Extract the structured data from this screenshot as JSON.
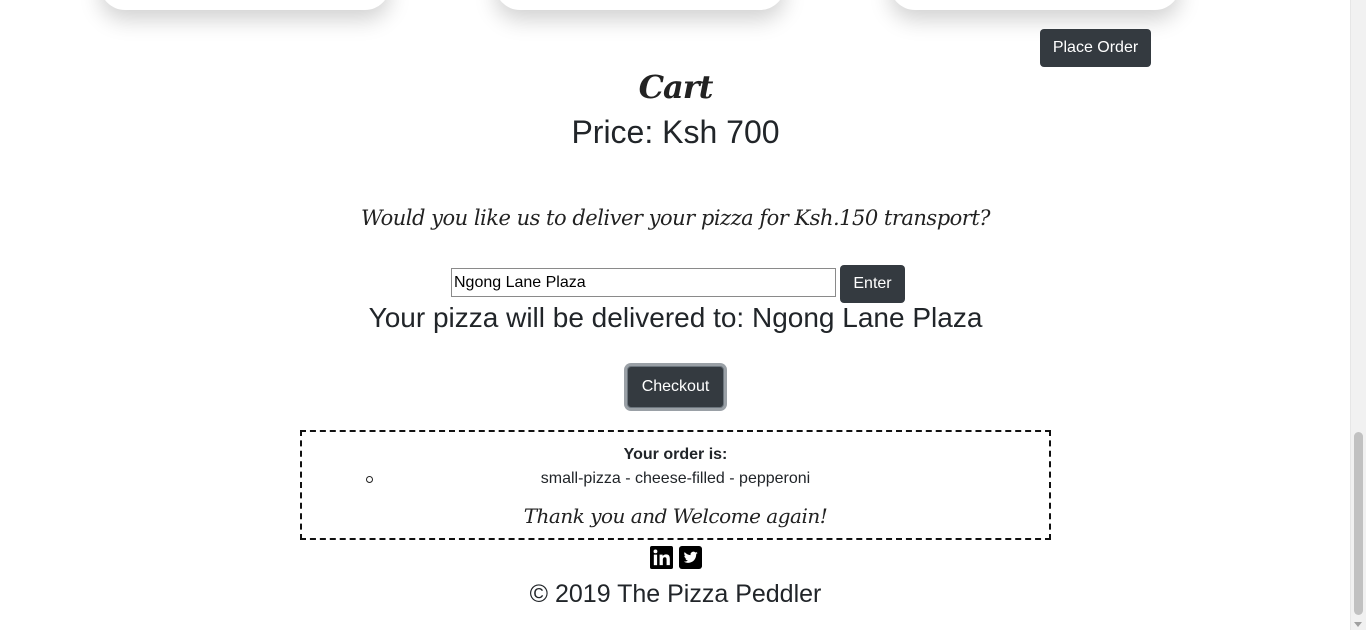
{
  "header": {
    "place_order_label": "Place Order"
  },
  "cart": {
    "title": "Cart",
    "price_text": "Price: Ksh 700"
  },
  "delivery": {
    "question": "Would you like us to deliver your pizza for Ksh.150 transport?",
    "address_value": "Ngong Lane Plaza",
    "enter_label": "Enter",
    "delivered_to_text": "Your pizza will be delivered to: Ngong Lane Plaza"
  },
  "checkout": {
    "label": "Checkout"
  },
  "order": {
    "heading": "Your order is:",
    "items": [
      "small-pizza - cheese-filled - pepperoni"
    ],
    "thanks": "Thank you and Welcome again!"
  },
  "footer": {
    "icons": [
      "linkedin-icon",
      "twitter-icon"
    ],
    "copyright": "© 2019 The Pizza Peddler"
  },
  "colors": {
    "button_bg": "#343a40",
    "button_text": "#ffffff",
    "text": "#212529"
  }
}
